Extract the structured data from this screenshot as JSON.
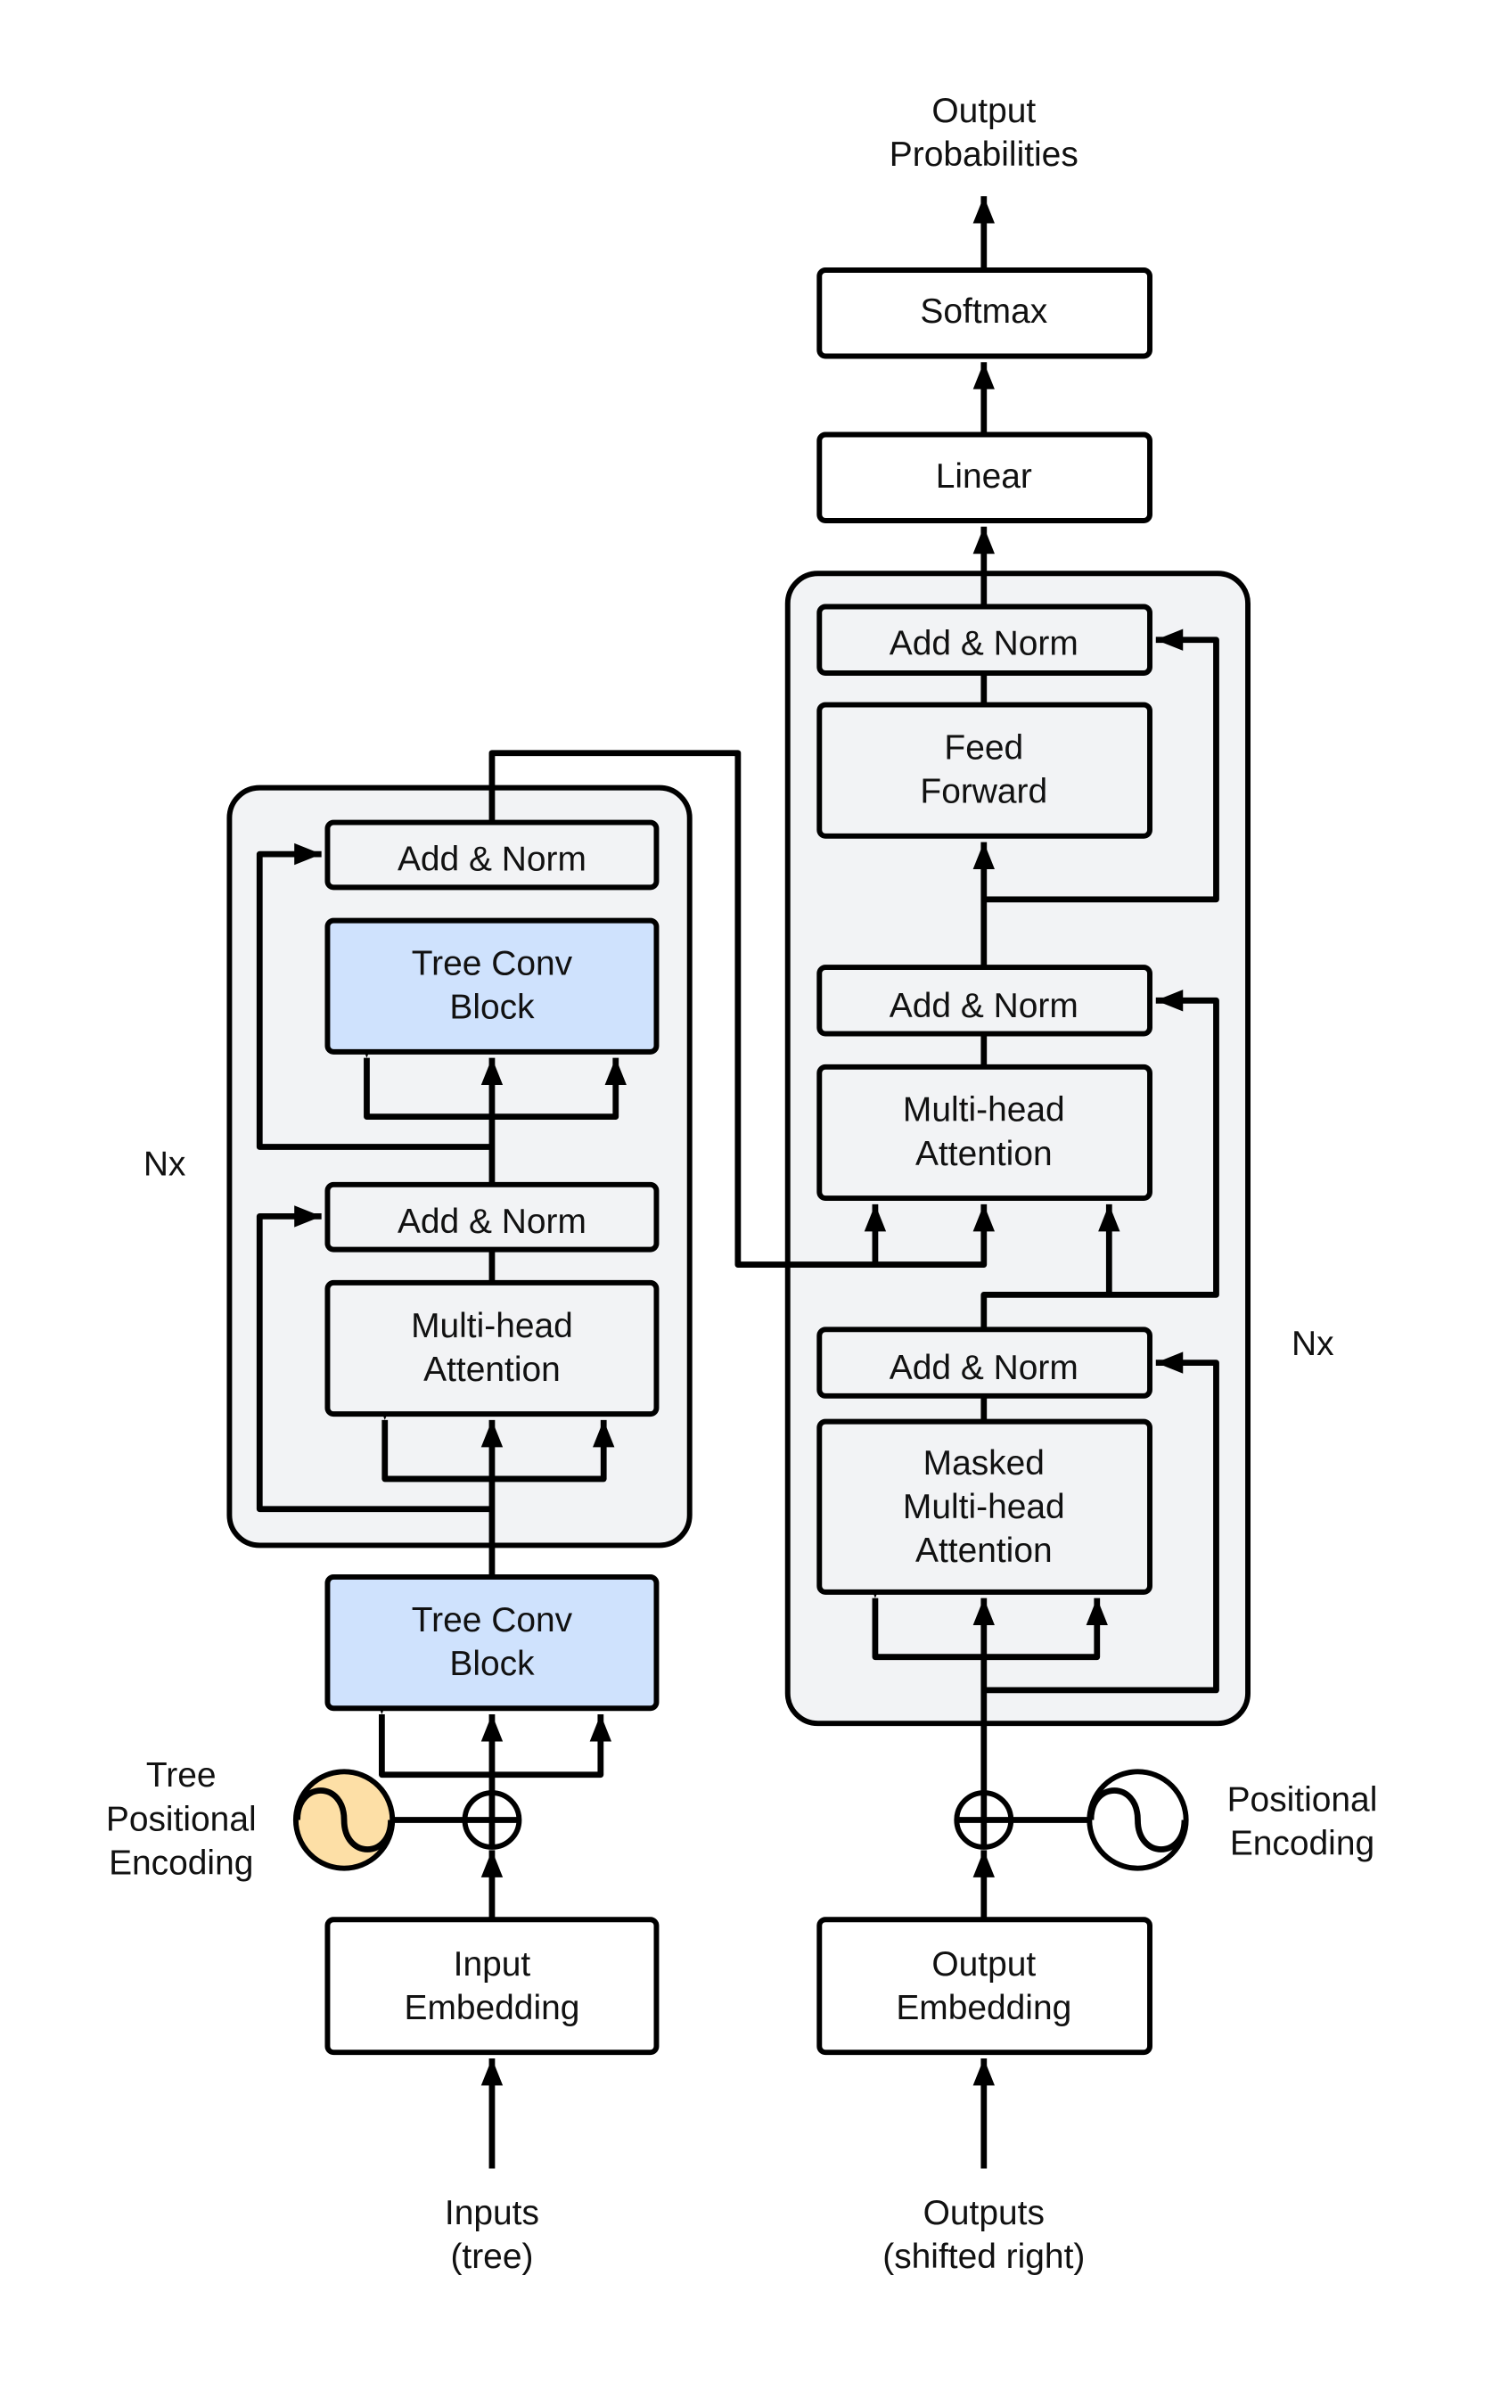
{
  "colors": {
    "block_fill": "#f2f3f5",
    "tree_conv_fill": "#cfe2fd",
    "tree_pe_fill": "#fddfa6",
    "stroke": "#000000"
  },
  "encoder": {
    "repeat_label": "Nx",
    "add_norm_top": "Add & Norm",
    "tree_conv": [
      "Tree Conv",
      "Block"
    ],
    "add_norm_bottom": "Add & Norm",
    "attention": [
      "Multi-head",
      "Attention"
    ],
    "input_tree_conv": [
      "Tree Conv",
      "Block"
    ],
    "positional_encoding": [
      "Tree",
      "Positional",
      "Encoding"
    ],
    "embedding": [
      "Input",
      "Embedding"
    ],
    "input_label": [
      "Inputs",
      "(tree)"
    ]
  },
  "decoder": {
    "repeat_label": "Nx",
    "output_label": [
      "Output",
      "Probabilities"
    ],
    "softmax": "Softmax",
    "linear": "Linear",
    "add_norm_3": "Add & Norm",
    "feed_forward": [
      "Feed",
      "Forward"
    ],
    "add_norm_2": "Add & Norm",
    "attention": [
      "Multi-head",
      "Attention"
    ],
    "add_norm_1": "Add & Norm",
    "masked_attention": [
      "Masked",
      "Multi-head",
      "Attention"
    ],
    "positional_encoding": [
      "Positional",
      "Encoding"
    ],
    "embedding": [
      "Output",
      "Embedding"
    ],
    "input_label": [
      "Outputs",
      "(shifted right)"
    ]
  }
}
